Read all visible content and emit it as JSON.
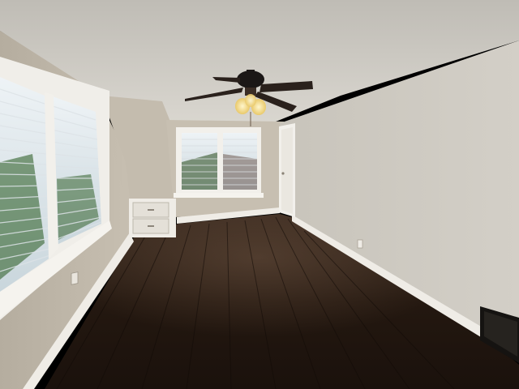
{
  "scene": {
    "subject": "empty-attic-bedroom",
    "colors": {
      "ceiling": "#d6d3cc",
      "wall_right": "#cfcbc3",
      "wall_back": "#c9c2b4",
      "wall_left": "#c2bcaf",
      "floor_dark": "#1e140f",
      "floor_mid": "#33241a",
      "trim": "#f1efea",
      "fan_body": "#1b1716",
      "light_glow": "#f6e7a8",
      "window_sky": "#e8eef2",
      "foliage": "#3f6b3a"
    },
    "objects": [
      "ceiling-fan",
      "left-window",
      "back-window",
      "closet-door",
      "built-in-drawers",
      "floor-vent",
      "electrical-outlet",
      "hardwood-floor"
    ]
  }
}
